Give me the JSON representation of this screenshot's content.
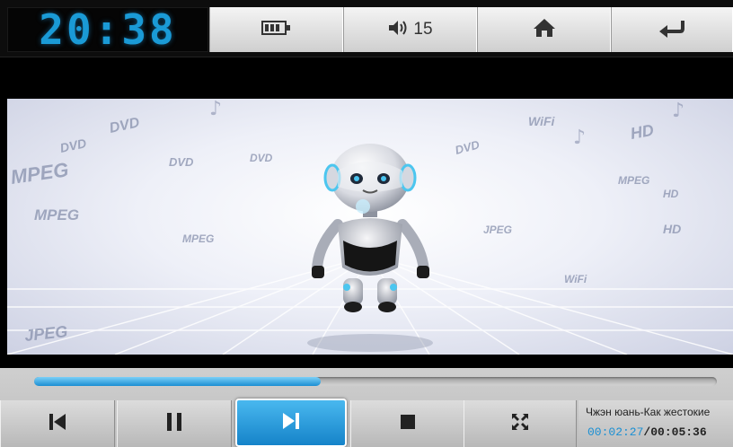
{
  "clock": {
    "time": "20:38"
  },
  "topbar": {
    "battery_icon": "battery-icon",
    "volume_icon": "speaker-icon",
    "volume_level": "15",
    "home_icon": "home-icon",
    "back_icon": "back-arrow-icon"
  },
  "video": {
    "labels": [
      "DVD",
      "MPEG",
      "DVD",
      "HD",
      "MPEG",
      "WiFi",
      "MPEG",
      "JPEG",
      "HD",
      "DVD",
      "MPEG",
      "DVD",
      "JPEG",
      "HD",
      "WiFi",
      "DVD"
    ]
  },
  "playback": {
    "progress_fraction": 0.42,
    "prev_icon": "skip-previous-icon",
    "pause_icon": "pause-icon",
    "next_icon": "skip-next-icon",
    "stop_icon": "stop-icon",
    "fullscreen_icon": "fullscreen-icon"
  },
  "track": {
    "title": "Чжэн юань-Как жестокие",
    "current_time": "00:02:27",
    "separator": "/",
    "total_time": "00:05:36"
  },
  "colors": {
    "accent": "#1a9ad6",
    "progress": "#1b8ed2"
  }
}
